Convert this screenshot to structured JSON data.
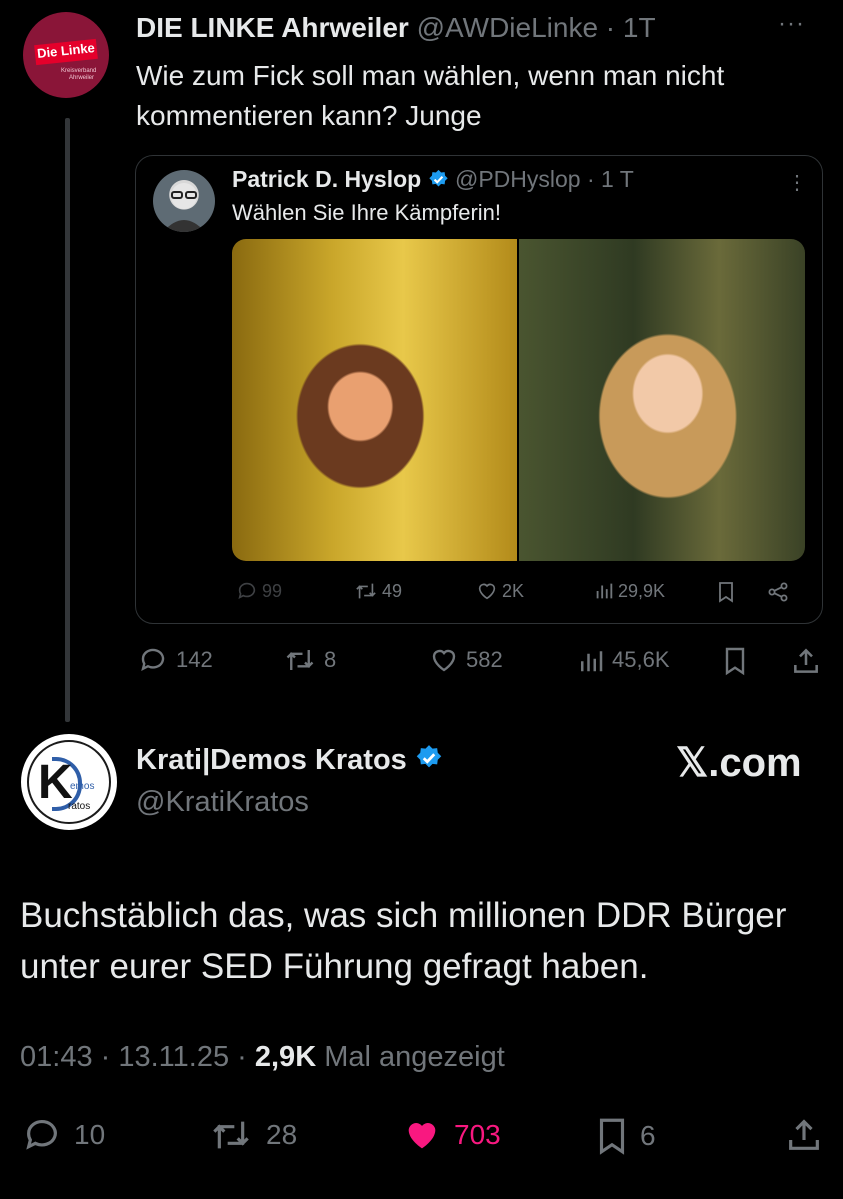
{
  "top_tweet": {
    "avatar_logo_text": "Die Linke",
    "avatar_sub1": "Kreisverband",
    "avatar_sub2": "Ahrweiler",
    "name": "DIE LINKE Ahrweiler",
    "handle": "@AWDieLinke",
    "time": "1T",
    "more": "···",
    "text": "Wie zum Fick soll man wählen, wenn man nicht kommentieren kann? Junge",
    "quote": {
      "name": "Patrick D. Hyslop",
      "handle": "@PDHyslop",
      "time": "1 T",
      "more": "⋮",
      "text": "Wählen Sie Ihre Kämpferin!",
      "replies": "99",
      "reposts": "49",
      "likes": "2K",
      "views": "29,9K"
    },
    "replies": "142",
    "reposts": "8",
    "likes": "582",
    "views": "45,6K"
  },
  "main_tweet": {
    "avatar_text1": "emos",
    "avatar_text2": "ratos",
    "name": "Krati|Demos Kratos",
    "handle": "@KratiKratos",
    "watermark": "𝕏.com",
    "text": "Buchstäblich das, was sich millionen DDR Bürger unter eurer SED Führung gefragt haben.",
    "time": "01:43",
    "date": "13.11.25",
    "views": "2,9K",
    "views_label": "Mal angezeigt",
    "replies": "10",
    "reposts": "28",
    "likes": "703",
    "bookmarks": "6"
  },
  "colors": {
    "background": "#000000",
    "text": "#e7e9ea",
    "muted": "#71767b",
    "verified": "#1d9bf0",
    "like_active": "#f91880"
  }
}
